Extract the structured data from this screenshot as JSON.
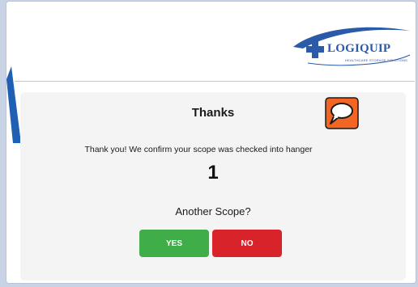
{
  "logo": {
    "wordmark": "LOGIQUIP",
    "tagline": "HEALTHCARE STORAGE SOLUTIONS",
    "cross_color": "#2a5aa8",
    "swoosh_color": "#2a5aa8"
  },
  "card": {
    "title": "Thanks",
    "message": "Thank you! We confirm your scope was checked into hanger",
    "count": "1",
    "question": "Another Scope?",
    "yes_label": "YES",
    "no_label": "NO",
    "chat_icon": "speech-bubble-icon",
    "chat_icon_color": "#f26522"
  },
  "colors": {
    "yes": "#3fae49",
    "no": "#d8232a",
    "background": "#c9d3e6"
  }
}
